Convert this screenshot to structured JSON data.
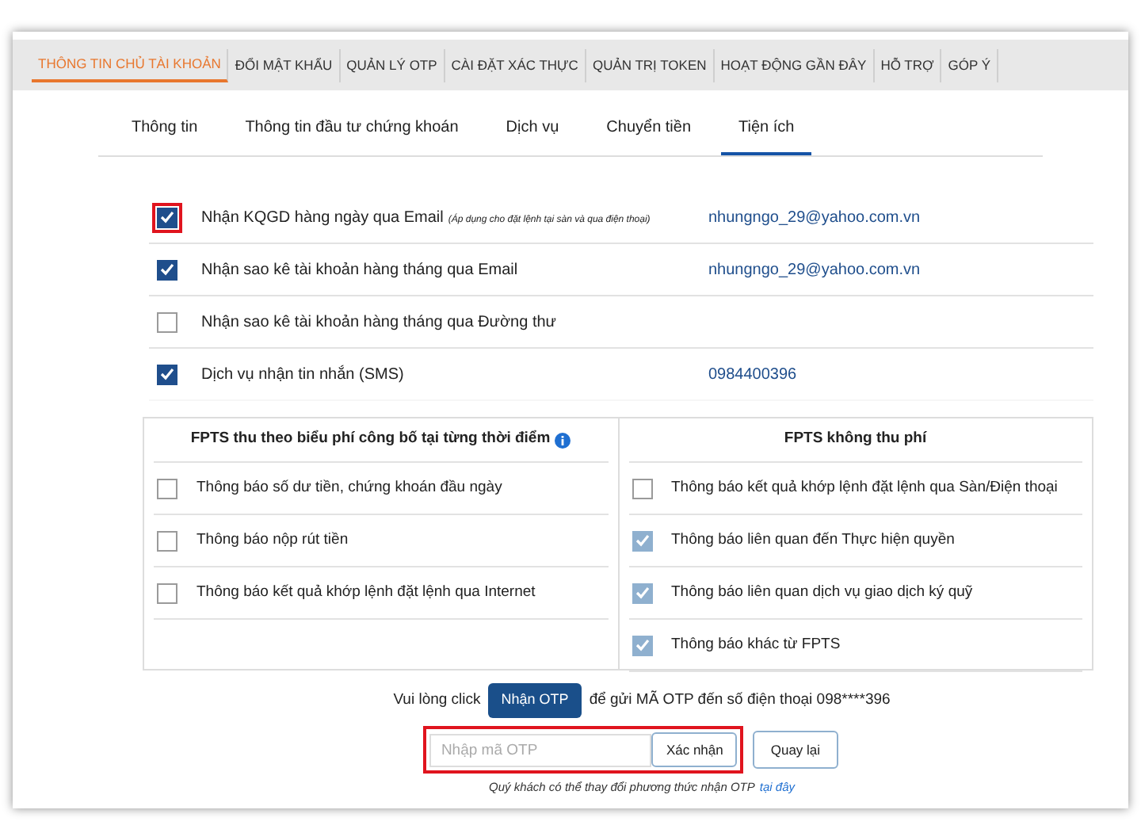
{
  "main_tabs": [
    {
      "label": "THÔNG TIN CHỦ TÀI KHOẢN",
      "selected": true
    },
    {
      "label": "ĐỔI MẬT KHẨU",
      "selected": false
    },
    {
      "label": "QUẢN LÝ OTP",
      "selected": false
    },
    {
      "label": "CÀI ĐẶT XÁC THỰC",
      "selected": false
    },
    {
      "label": "QUẢN TRỊ TOKEN",
      "selected": false
    },
    {
      "label": "HOẠT ĐỘNG GẦN ĐÂY",
      "selected": false
    },
    {
      "label": "HỖ TRỢ",
      "selected": false
    },
    {
      "label": "GÓP Ý",
      "selected": false
    }
  ],
  "sub_tabs": [
    {
      "label": "Thông tin",
      "selected": false
    },
    {
      "label": "Thông tin đầu tư chứng khoán",
      "selected": false
    },
    {
      "label": "Dịch vụ",
      "selected": false
    },
    {
      "label": "Chuyển tiền",
      "selected": false
    },
    {
      "label": "Tiện ích",
      "selected": true
    }
  ],
  "options": [
    {
      "label": "Nhận KQGD hàng ngày qua Email",
      "note": "(Áp dụng cho đặt lệnh tại sàn và qua điện thoại)",
      "value": "nhungngo_29@yahoo.com.vn",
      "checked": true,
      "highlighted": true
    },
    {
      "label": "Nhận sao kê tài khoản hàng tháng qua Email",
      "value": "nhungngo_29@yahoo.com.vn",
      "checked": true,
      "highlighted": false
    },
    {
      "label": "Nhận sao kê tài khoản hàng tháng qua Đường thư",
      "checked": false,
      "highlighted": false
    },
    {
      "label": "Dịch vụ nhận tin nhắn (SMS)",
      "value": "0984400396",
      "checked": true,
      "highlighted": false
    }
  ],
  "panels": [
    {
      "title": "FPTS thu theo biểu phí công bố tại từng thời điểm",
      "info": true,
      "items": [
        {
          "label": "Thông báo số dư tiền, chứng khoán đầu ngày",
          "checked": false,
          "disabled": false
        },
        {
          "label": "Thông báo nộp rút tiền",
          "checked": false,
          "disabled": false
        },
        {
          "label": "Thông báo kết quả khớp lệnh đặt lệnh qua Internet",
          "checked": false,
          "disabled": false
        }
      ]
    },
    {
      "title": "FPTS không thu phí",
      "info": false,
      "items": [
        {
          "label": "Thông báo kết quả khớp lệnh đặt lệnh qua Sàn/Điện thoại",
          "checked": false,
          "disabled": false
        },
        {
          "label": "Thông báo liên quan đến Thực hiện quyền",
          "checked": true,
          "disabled": true
        },
        {
          "label": "Thông báo liên quan dịch vụ giao dịch ký quỹ",
          "checked": true,
          "disabled": true
        },
        {
          "label": "Thông báo khác từ FPTS",
          "checked": true,
          "disabled": true
        }
      ]
    }
  ],
  "otp": {
    "prompt_before": "Vui lòng click",
    "get_button": "Nhận OTP",
    "prompt_after": "để gửi MÃ OTP đến số điện thoại 098****396",
    "placeholder": "Nhập mã OTP",
    "confirm_button": "Xác nhận",
    "back_button": "Quay lại",
    "highlighted": true,
    "note": "Quý khách có thể thay đổi phương thức nhận OTP",
    "note_link": "tại đây"
  }
}
